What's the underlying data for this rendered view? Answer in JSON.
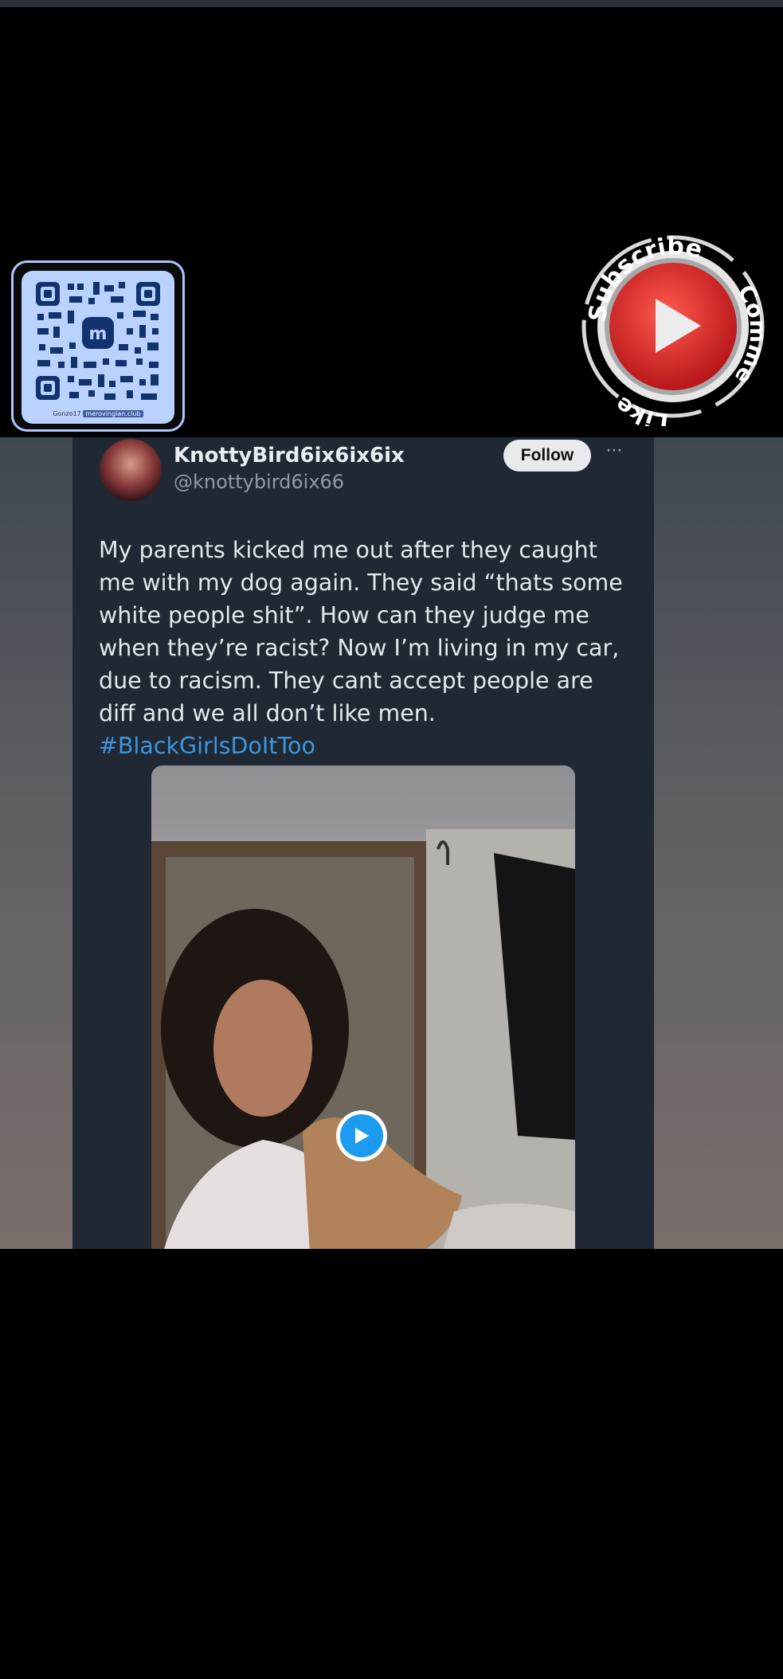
{
  "overlay": {
    "qr": {
      "caption_user": "Gonzo17",
      "caption_server": "merovingian.club",
      "faint_label": "Gonzo17"
    },
    "subscribe_badge": {
      "top_text": "Subscribe",
      "right_text": "Comment",
      "bottom_text": "Like",
      "icon": "play-icon",
      "accent_color": "#d62b2b"
    }
  },
  "tweet": {
    "display_name": "KnottyBird6ix6ix6ix",
    "handle": "@knottybird6ix66",
    "follow_label": "Follow",
    "more_label": "···",
    "body": "My parents kicked me out after they caught me with my dog again. They said “thats some white people shit”. How can they judge me when they’re racist? Now I’m living in my car, due to racism. They cant accept people are diff and we all don’t like men.",
    "hashtag": "#BlackGirlsDoItToo",
    "hashtag_color": "#3d97e0",
    "media": {
      "play_icon": "play-icon",
      "play_color": "#1d9bf0"
    }
  }
}
